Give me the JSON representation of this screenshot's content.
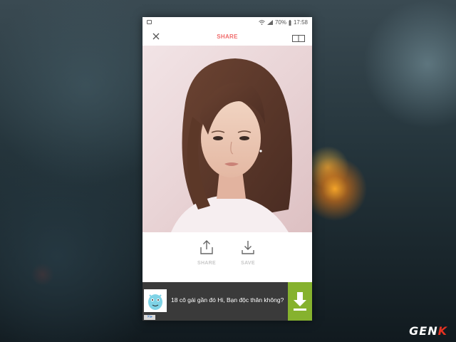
{
  "status_bar": {
    "battery_percent": "70%",
    "time": "17:58",
    "icons": [
      "gallery-icon",
      "wifi-icon",
      "signal-icon",
      "battery-icon"
    ]
  },
  "app_bar": {
    "title": "SHARE",
    "title_color": "#f06b6b",
    "left_icon": "close-icon",
    "right_icon": "layout-icon"
  },
  "photo": {
    "subject": "portrait photo"
  },
  "actions": {
    "share_label": "SHARE",
    "save_label": "SAVE",
    "share_icon": "share-icon",
    "save_icon": "download-icon"
  },
  "ad": {
    "text": "18 cô gái gần đó Hi, Bạn độc thân không?",
    "button_icon": "download-icon",
    "button_color": "#86b22e"
  },
  "watermark": {
    "text_main": "GEN",
    "text_accent": "K",
    "accent_color": "#e53222"
  }
}
